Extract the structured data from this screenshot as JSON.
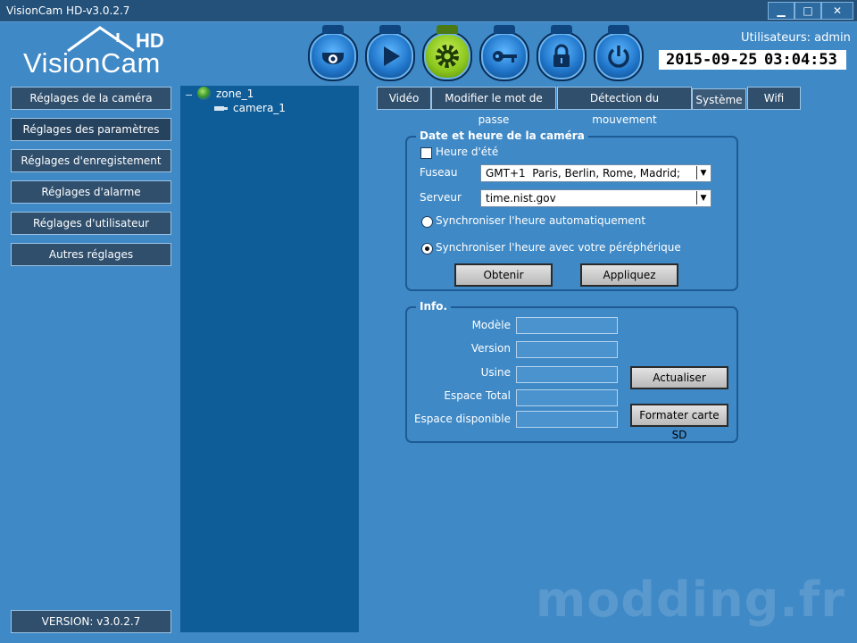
{
  "window": {
    "title": "VisionCam HD-v3.0.2.7",
    "controls": {
      "minimize": "▁",
      "maximize": "□",
      "close": "✕"
    }
  },
  "header": {
    "logo_word": "VisionCam",
    "logo_badge": "HD",
    "nav_icons": [
      "camera-dome-icon",
      "play-icon",
      "gear-icon",
      "key-icon",
      "lock-icon",
      "power-icon"
    ],
    "active_icon": "gear-icon",
    "users_text": "Utilisateurs: admin",
    "date": "2015-09-25",
    "time": "03:04:53"
  },
  "sidebar": {
    "items": [
      {
        "label": "Réglages de la caméra"
      },
      {
        "label": "Réglages des paramètres"
      },
      {
        "label": "Réglages d'enregistement"
      },
      {
        "label": "Réglages d'alarme"
      },
      {
        "label": "Réglages d'utilisateur"
      },
      {
        "label": "Autres réglages"
      }
    ],
    "active_index": 1,
    "version": "VERSION: v3.0.2.7"
  },
  "tree": {
    "toggle": "−",
    "zone": "zone_1",
    "camera": "camera_1"
  },
  "tabs": {
    "items": [
      {
        "label": "Vidéo"
      },
      {
        "label": "Modifier le mot de passe"
      },
      {
        "label": "Détection du mouvement"
      },
      {
        "label": "Système"
      },
      {
        "label": "Wifi"
      }
    ],
    "active": "Système"
  },
  "datetime_group": {
    "legend": "Date et heure de la caméra",
    "dst_label": "Heure d'été",
    "dst_checked": false,
    "timezone_label": "Fuseau",
    "timezone_value": "GMT+1  Paris, Berlin, Rome, Madrid;",
    "server_label": "Serveur",
    "server_value": "time.nist.gov",
    "auto_sync_label": "Synchroniser l'heure automatiquement",
    "device_sync_label": "Synchroniser l'heure avec votre péréphérique",
    "selected_sync": "device",
    "get_button": "Obtenir",
    "apply_button": "Appliquez"
  },
  "info_group": {
    "legend": "Info.",
    "fields": [
      {
        "label": "Modèle",
        "value": ""
      },
      {
        "label": "Version",
        "value": ""
      },
      {
        "label": "Usine",
        "value": ""
      },
      {
        "label": "Espace Total",
        "value": ""
      },
      {
        "label": "Espace disponible",
        "value": ""
      }
    ],
    "refresh_button": "Actualiser",
    "format_button": "Formater carte SD"
  },
  "watermark": "modding.fr",
  "colors": {
    "background": "#3f89c6",
    "tree_panel": "#0f5d98",
    "button_dark": "#2f4f6d",
    "active_nav": "#8ac51c"
  }
}
